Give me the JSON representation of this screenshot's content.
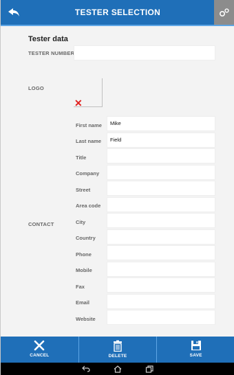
{
  "header": {
    "title": "TESTER SELECTION",
    "back_icon": "back-arrow-icon",
    "settings_icon": "settings-icon"
  },
  "form": {
    "section_title": "Tester data",
    "tester_number": {
      "label": "TESTER NUMBER",
      "value": ""
    },
    "logo": {
      "label": "LOGO",
      "remove_icon": "remove-x-icon"
    },
    "contact": {
      "label": "CONTACT",
      "fields": [
        {
          "label": "First name",
          "value": "Mike"
        },
        {
          "label": "Last name",
          "value": "Field"
        },
        {
          "label": "Title",
          "value": ""
        },
        {
          "label": "Company",
          "value": ""
        },
        {
          "label": "Street",
          "value": ""
        },
        {
          "label": "Area code",
          "value": ""
        },
        {
          "label": "City",
          "value": ""
        },
        {
          "label": "Country",
          "value": ""
        },
        {
          "label": "Phone",
          "value": ""
        },
        {
          "label": "Mobile",
          "value": ""
        },
        {
          "label": "Fax",
          "value": ""
        },
        {
          "label": "Email",
          "value": ""
        },
        {
          "label": "Website",
          "value": ""
        }
      ]
    }
  },
  "bottombar": {
    "cancel_label": "CANCEL",
    "delete_label": "DELETE",
    "save_label": "SAVE"
  },
  "colors": {
    "header_bg": "#1f6fb8",
    "settings_bg": "#8c8c8c",
    "remove_red": "#e0201e"
  }
}
